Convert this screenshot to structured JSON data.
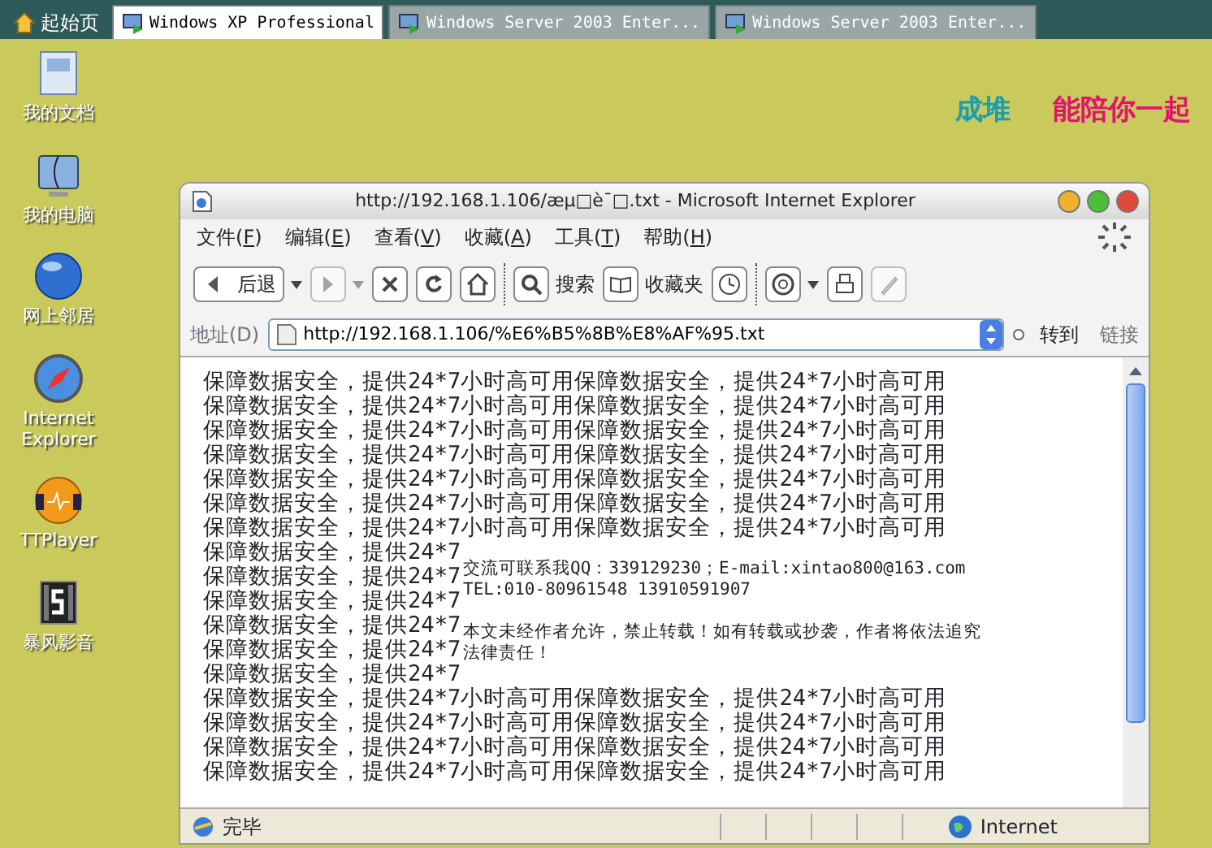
{
  "tabs": [
    {
      "label": "起始页",
      "kind": "home",
      "selected": false
    },
    {
      "label": "Windows XP Professional",
      "kind": "vm",
      "selected": true
    },
    {
      "label": "Windows Server 2003 Enter...",
      "kind": "vm",
      "selected": false
    },
    {
      "label": "Windows Server 2003 Enter...",
      "kind": "vm",
      "selected": false
    }
  ],
  "desktop": {
    "icons": [
      {
        "label": "我的文档",
        "kind": "documents"
      },
      {
        "label": "我的电脑",
        "kind": "computer"
      },
      {
        "label": "网上邻居",
        "kind": "network"
      },
      {
        "label": "Internet Explorer",
        "kind": "compass"
      },
      {
        "label": "TTPlayer",
        "kind": "player"
      },
      {
        "label": "暴风影音",
        "kind": "film"
      }
    ],
    "wallpaper_texts": [
      {
        "text": "成堆",
        "color": "#1a9fb0"
      },
      {
        "text": "能陪你一起",
        "color": "#e0146e"
      }
    ]
  },
  "browser": {
    "title": "http://192.168.1.106/æµ□è¯□.txt - Microsoft Internet Explorer",
    "menu": [
      {
        "before": "文件(",
        "key": "F",
        "after": ")"
      },
      {
        "before": "编辑(",
        "key": "E",
        "after": ")"
      },
      {
        "before": "查看(",
        "key": "V",
        "after": ")"
      },
      {
        "before": "收藏(",
        "key": "A",
        "after": ")"
      },
      {
        "before": "工具(",
        "key": "T",
        "after": ")"
      },
      {
        "before": "帮助(",
        "key": "H",
        "after": ")"
      }
    ],
    "toolbar": [
      {
        "kind": "back",
        "label": "后退",
        "dropdown": true,
        "disabled": false
      },
      {
        "kind": "forward",
        "dropdown": true,
        "disabled": true
      },
      {
        "kind": "stop",
        "disabled": false
      },
      {
        "kind": "refresh",
        "disabled": false
      },
      {
        "kind": "home",
        "disabled": false
      },
      {
        "kind": "separator"
      },
      {
        "kind": "search",
        "label": "搜索",
        "disabled": false
      },
      {
        "kind": "favorites",
        "label": "收藏夹",
        "disabled": false
      },
      {
        "kind": "history",
        "disabled": false
      },
      {
        "kind": "separator"
      },
      {
        "kind": "mail",
        "dropdown": true,
        "disabled": false
      },
      {
        "kind": "print",
        "disabled": false
      },
      {
        "kind": "edit",
        "disabled": true
      }
    ],
    "address": {
      "label": "地址(D)",
      "value": "http://192.168.1.106/%E6%B5%8B%E8%AF%95.txt",
      "go": "转到",
      "links": "链接"
    },
    "document": {
      "lines": [
        "保障数据安全，提供24*7小时高可用保障数据安全，提供24*7小时高可用",
        "保障数据安全，提供24*7小时高可用保障数据安全，提供24*7小时高可用",
        "保障数据安全，提供24*7小时高可用保障数据安全，提供24*7小时高可用",
        "保障数据安全，提供24*7小时高可用保障数据安全，提供24*7小时高可用",
        "保障数据安全，提供24*7小时高可用保障数据安全，提供24*7小时高可用",
        "保障数据安全，提供24*7小时高可用保障数据安全，提供24*7小时高可用",
        "保障数据安全，提供24*7小时高可用保障数据安全，提供24*7小时高可用",
        "保障数据安全，提供24*7",
        "保障数据安全，提供24*7",
        "保障数据安全，提供24*7",
        "保障数据安全，提供24*7",
        "保障数据安全，提供24*7",
        "保障数据安全，提供24*7",
        "保障数据安全，提供24*7小时高可用保障数据安全，提供24*7小时高可用",
        "保障数据安全，提供24*7小时高可用保障数据安全，提供24*7小时高可用",
        "保障数据安全，提供24*7小时高可用保障数据安全，提供24*7小时高可用",
        "保障数据安全，提供24*7小时高可用保障数据安全，提供24*7小时高可用"
      ],
      "note": [
        "交流可联系我QQ：339129230；E-mail:xintao800@163.com",
        "TEL:010-80961548 13910591907",
        "本文未经作者允许，禁止转载！如有转载或抄袭，作者将依法追究",
        "法律责任！"
      ]
    },
    "status": {
      "text": "完毕",
      "zone": "Internet"
    }
  }
}
